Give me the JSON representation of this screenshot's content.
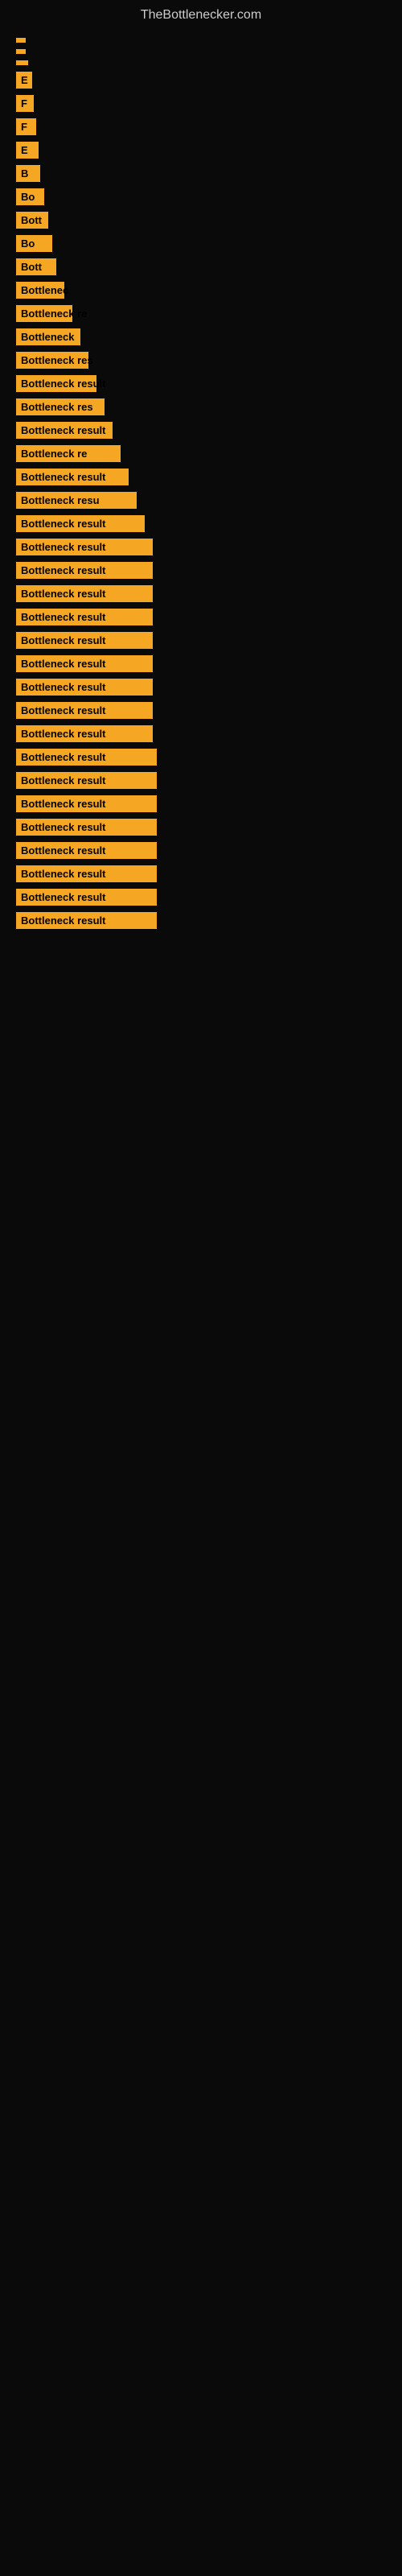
{
  "site": {
    "title": "TheBottlenecker.com"
  },
  "items": [
    {
      "id": 1,
      "label": "",
      "widthClass": "w1"
    },
    {
      "id": 2,
      "label": "",
      "widthClass": "w2"
    },
    {
      "id": 3,
      "label": "",
      "widthClass": "w3"
    },
    {
      "id": 4,
      "label": "E",
      "widthClass": "w4"
    },
    {
      "id": 5,
      "label": "F",
      "widthClass": "w5"
    },
    {
      "id": 6,
      "label": "F",
      "widthClass": "w6"
    },
    {
      "id": 7,
      "label": "E",
      "widthClass": "w7"
    },
    {
      "id": 8,
      "label": "B",
      "widthClass": "w8"
    },
    {
      "id": 9,
      "label": "Bo",
      "widthClass": "w9"
    },
    {
      "id": 10,
      "label": "Bott",
      "widthClass": "w10"
    },
    {
      "id": 11,
      "label": "Bo",
      "widthClass": "w11"
    },
    {
      "id": 12,
      "label": "Bott",
      "widthClass": "w12"
    },
    {
      "id": 13,
      "label": "Bottlenec",
      "widthClass": "w13"
    },
    {
      "id": 14,
      "label": "Bottleneck re",
      "widthClass": "w14"
    },
    {
      "id": 15,
      "label": "Bottleneck",
      "widthClass": "w15"
    },
    {
      "id": 16,
      "label": "Bottleneck res",
      "widthClass": "w16"
    },
    {
      "id": 17,
      "label": "Bottleneck result",
      "widthClass": "w17"
    },
    {
      "id": 18,
      "label": "Bottleneck res",
      "widthClass": "w18"
    },
    {
      "id": 19,
      "label": "Bottleneck result",
      "widthClass": "w19"
    },
    {
      "id": 20,
      "label": "Bottleneck re",
      "widthClass": "w20"
    },
    {
      "id": 21,
      "label": "Bottleneck result",
      "widthClass": "w21"
    },
    {
      "id": 22,
      "label": "Bottleneck resu",
      "widthClass": "w22"
    },
    {
      "id": 23,
      "label": "Bottleneck result",
      "widthClass": "w23"
    },
    {
      "id": 24,
      "label": "Bottleneck result",
      "widthClass": "w24"
    },
    {
      "id": 25,
      "label": "Bottleneck result",
      "widthClass": "w24"
    },
    {
      "id": 26,
      "label": "Bottleneck result",
      "widthClass": "w24"
    },
    {
      "id": 27,
      "label": "Bottleneck result",
      "widthClass": "w24"
    },
    {
      "id": 28,
      "label": "Bottleneck result",
      "widthClass": "w24"
    },
    {
      "id": 29,
      "label": "Bottleneck result",
      "widthClass": "w24"
    },
    {
      "id": 30,
      "label": "Bottleneck result",
      "widthClass": "w24"
    },
    {
      "id": 31,
      "label": "Bottleneck result",
      "widthClass": "w24"
    },
    {
      "id": 32,
      "label": "Bottleneck result",
      "widthClass": "w24"
    },
    {
      "id": 33,
      "label": "Bottleneck result",
      "widthClass": "w25"
    },
    {
      "id": 34,
      "label": "Bottleneck result",
      "widthClass": "w25"
    },
    {
      "id": 35,
      "label": "Bottleneck result",
      "widthClass": "w25"
    },
    {
      "id": 36,
      "label": "Bottleneck result",
      "widthClass": "w25"
    },
    {
      "id": 37,
      "label": "Bottleneck result",
      "widthClass": "w25"
    },
    {
      "id": 38,
      "label": "Bottleneck result",
      "widthClass": "w25"
    },
    {
      "id": 39,
      "label": "Bottleneck result",
      "widthClass": "w25"
    },
    {
      "id": 40,
      "label": "Bottleneck result",
      "widthClass": "w25"
    }
  ]
}
